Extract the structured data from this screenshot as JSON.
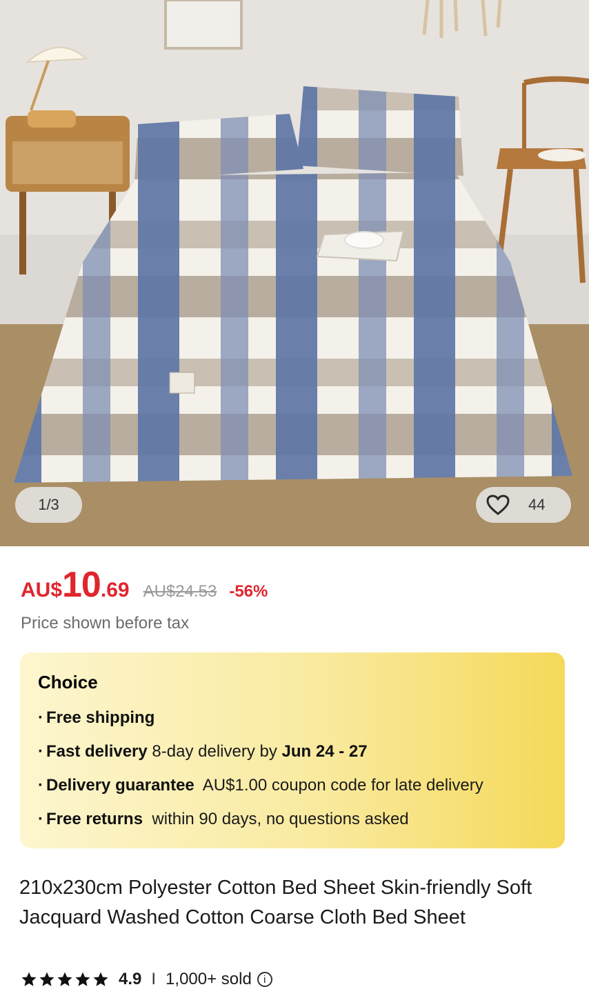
{
  "gallery": {
    "image_alt": "Blue and beige plaid bed sheet on a bed",
    "counter": "1/3",
    "likes": "44",
    "heart_icon": "heart-outline-icon"
  },
  "price": {
    "currency": "AU$",
    "integer": "10",
    "decimal": ".69",
    "original": "AU$24.53",
    "discount": "-56%",
    "tax_note": "Price shown before tax",
    "color": "#e0252e"
  },
  "choice": {
    "title": "Choice",
    "benefits": [
      {
        "bold": "Free shipping",
        "text": "",
        "highlight": ""
      },
      {
        "bold": "Fast delivery",
        "text": " 8-day delivery by ",
        "highlight": "Jun 24 - 27"
      },
      {
        "bold": "Delivery guarantee",
        "text": "  AU$1.00 coupon code for late delivery",
        "highlight": ""
      },
      {
        "bold": "Free returns",
        "text": "  within 90 days, no questions asked",
        "highlight": ""
      }
    ]
  },
  "product": {
    "title": "210x230cm Polyester Cotton Bed Sheet Skin-friendly Soft Jacquard Washed Cotton Coarse Cloth Bed Sheet"
  },
  "rating": {
    "stars": 5,
    "value": "4.9",
    "separator": "I",
    "sold": "1,000+ sold",
    "info_icon": "info-icon"
  }
}
